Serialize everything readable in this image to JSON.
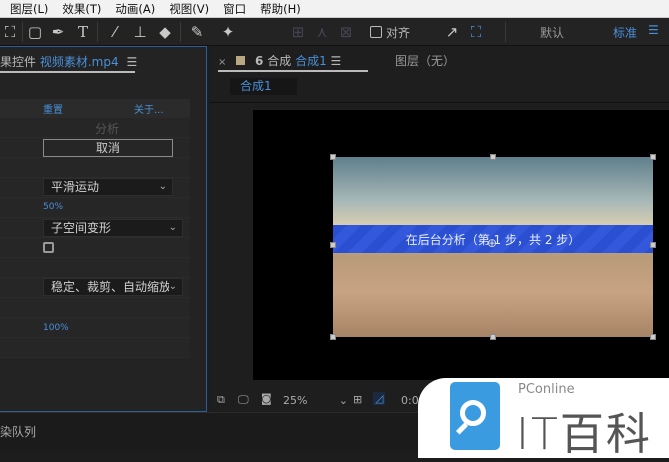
{
  "menu": [
    "图层(L)",
    "效果(T)",
    "动画(A)",
    "视图(V)",
    "窗口",
    "帮助(H)"
  ],
  "toolbar": {
    "snap_label": "对齐",
    "workspace_default": "默认",
    "workspace_standard": "标准"
  },
  "left_panel": {
    "title_prefix": "果控件",
    "title_file": "视频素材.mp4",
    "reset": "重置",
    "about": "关于...",
    "analyze": "分析",
    "cancel": "取消",
    "smooth": "平滑运动",
    "percent1": "50%",
    "method": "子空间变形",
    "framing": "稳定、裁剪、自动缩放",
    "percent2": "100%"
  },
  "comp_panel": {
    "tab_label": "合成",
    "tab_name": "合成1",
    "layer_label": "图层（无）",
    "subtab": "合成1",
    "overlay_text": "在后台分析（第 1 步，共 2 步）",
    "zoom": "25%",
    "timecode": "0:0"
  },
  "bottom": {
    "render_queue": "染队列"
  },
  "watermark": {
    "brand": "PConline",
    "name": "IT百科",
    "color": "#3a9be0"
  }
}
